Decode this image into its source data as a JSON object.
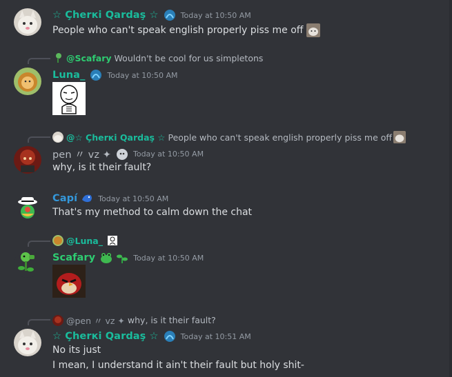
{
  "messages": [
    {
      "author": "☆ Çherкi Qardaş ☆",
      "author_color": "#1abc9c",
      "timestamp": "Today at 10:50 AM",
      "lines": [
        "People who can't speak english properly piss me off"
      ]
    },
    {
      "reply_to": {
        "author": "@Scafary",
        "text": "Wouldn't be cool for us simpletons"
      },
      "author": "Luna_",
      "author_color": "#1abc9c",
      "timestamp": "Today at 10:50 AM",
      "attachment": "meme-face-image"
    },
    {
      "reply_to": {
        "author": "@☆ Çherкi Qardaş ☆",
        "text": "People who can't speak english properly piss me off"
      },
      "author": "pen 〃 vz ✦",
      "author_color": "#b5bac1",
      "timestamp": "Today at 10:50 AM",
      "lines": [
        "why, is it their fault?"
      ]
    },
    {
      "author": "Capí",
      "author_color": "#3498db",
      "timestamp": "Today at 10:50 AM",
      "lines": [
        "That's my method to calm down the chat"
      ]
    },
    {
      "reply_to": {
        "author": "@Luna_",
        "text": ""
      },
      "author": "Scafary",
      "author_color": "#2ecc71",
      "timestamp": "Today at 10:50 AM",
      "attachment": "angry-bird-image"
    },
    {
      "reply_to": {
        "author": "@pen 〃 vz ✦",
        "text": "why, is it their fault?"
      },
      "author": "☆ Çherкi Qardaş ☆",
      "author_color": "#1abc9c",
      "timestamp": "Today at 10:51 AM",
      "lines": [
        "No its just",
        "I mean, I understand it ain't their fault but holy shit-"
      ]
    }
  ],
  "colors": {
    "background": "#313338",
    "text": "#dbdee1",
    "muted": "#949ba4"
  }
}
